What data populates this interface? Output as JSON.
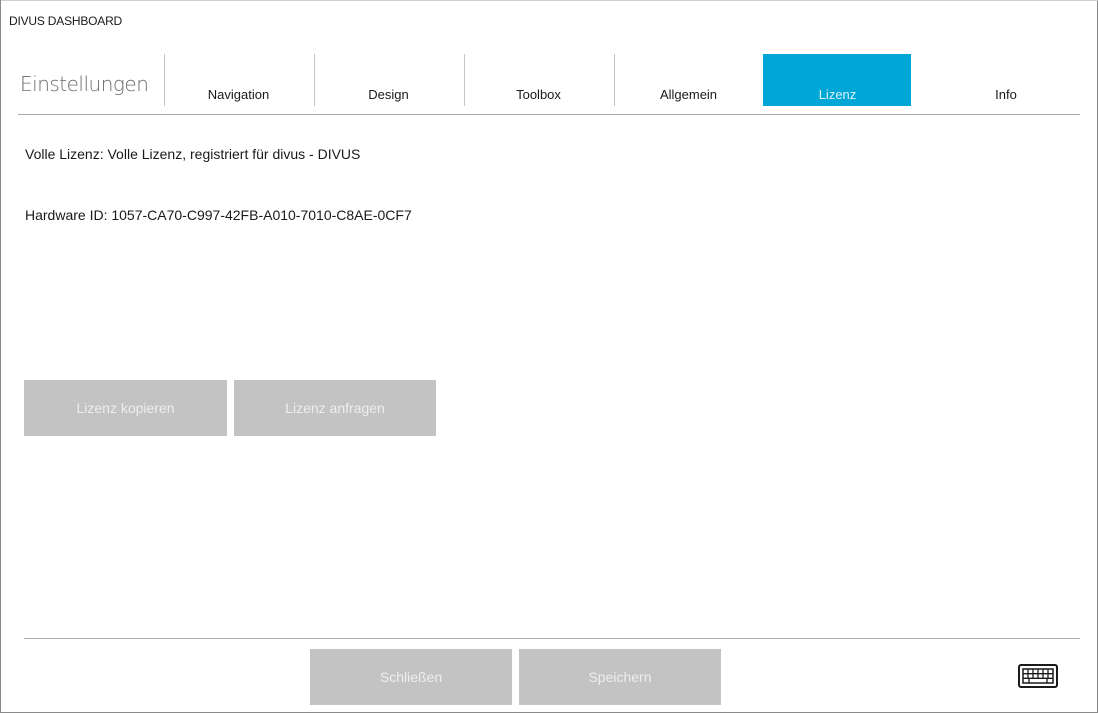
{
  "window": {
    "app_title": "DIVUS DASHBOARD"
  },
  "header": {
    "page_title": "Einstellungen",
    "tabs": [
      {
        "label": "Navigation",
        "active": false
      },
      {
        "label": "Design",
        "active": false
      },
      {
        "label": "Toolbox",
        "active": false
      },
      {
        "label": "Allgemein",
        "active": false
      },
      {
        "label": "Lizenz",
        "active": true
      },
      {
        "label": "Info",
        "active": false
      }
    ]
  },
  "license": {
    "status_line": "Volle Lizenz:  Volle Lizenz, registriert für divus - DIVUS",
    "hardware_line": "Hardware ID: 1057-CA70-C997-42FB-A010-7010-C8AE-0CF7",
    "copy_button": "Lizenz kopieren",
    "request_button": "Lizenz anfragen"
  },
  "footer": {
    "close_button": "Schließen",
    "save_button": "Speichern",
    "keyboard_icon": "keyboard-icon"
  },
  "colors": {
    "accent": "#00a6d6",
    "button_disabled": "#c3c3c3",
    "button_text": "#eeeeee"
  }
}
